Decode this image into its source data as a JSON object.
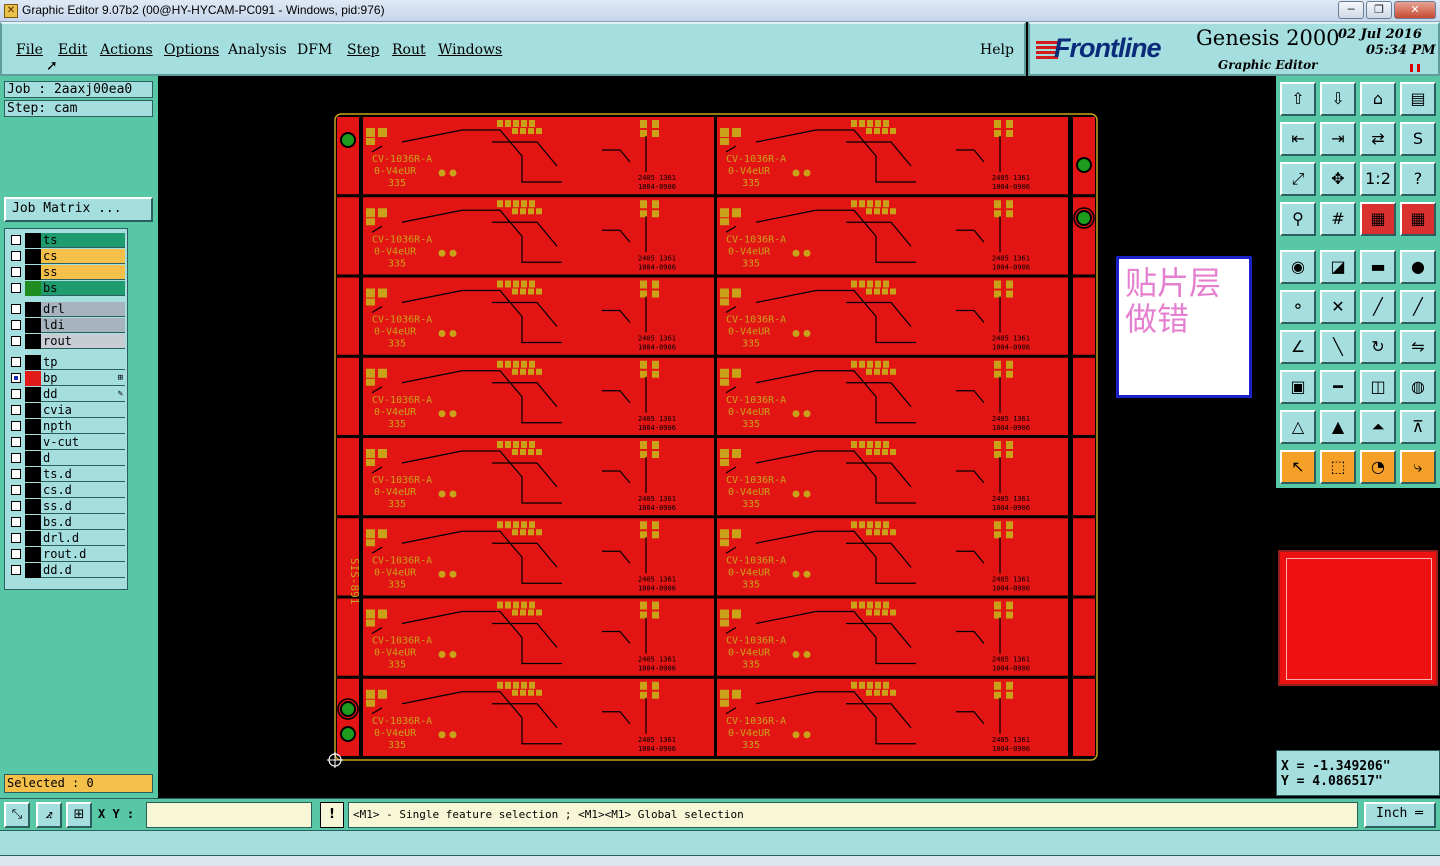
{
  "window": {
    "title": "Graphic Editor 9.07b2 (00@HY-HYCAM-PC091 - Windows, pid:976)",
    "minimize": "─",
    "restore": "❐",
    "close": "✕"
  },
  "menu": {
    "items": [
      "File",
      "Edit",
      "Actions",
      "Options",
      "Analysis",
      "DFM",
      "Step",
      "Rout",
      "Windows"
    ],
    "help": "Help"
  },
  "banner": {
    "logo": "Frontline",
    "product": "Genesis 2000",
    "subtitle": "Graphic Editor",
    "date": "02  Jul  2016",
    "time": "05:34  PM"
  },
  "left": {
    "job": "Job : 2aaxj00ea0",
    "step": "Step: cam",
    "job_matrix": "Job Matrix ...",
    "layers": [
      {
        "name": "ts",
        "color": "#1e9c6e",
        "swatch": "#000000",
        "checked": false
      },
      {
        "name": "cs",
        "color": "#f5c04a",
        "swatch": "#000000",
        "checked": false
      },
      {
        "name": "ss",
        "color": "#f5c04a",
        "swatch": "#000000",
        "checked": false
      },
      {
        "name": "bs",
        "color": "#1e9c6e",
        "swatch": "#1e8c1e",
        "checked": false
      },
      {
        "name": "drl",
        "color": "#a7b3bd",
        "swatch": "#000000",
        "checked": false,
        "gap": true
      },
      {
        "name": "ldi",
        "color": "#a7b3bd",
        "swatch": "#000000",
        "checked": false
      },
      {
        "name": "rout",
        "color": "#c7cdd2",
        "swatch": "#000000",
        "checked": false
      },
      {
        "name": "tp",
        "color": "#a5dede",
        "swatch": "#000000",
        "checked": false,
        "gap": true
      },
      {
        "name": "bp",
        "color": "#a5dede",
        "swatch": "#e31a1a",
        "checked": true,
        "mark": "⊞"
      },
      {
        "name": "dd",
        "color": "#a5dede",
        "swatch": "#000000",
        "checked": false,
        "mark": "✎"
      },
      {
        "name": "cvia",
        "color": "#a5dede",
        "swatch": "#000000",
        "checked": false
      },
      {
        "name": "npth",
        "color": "#a5dede",
        "swatch": "#000000",
        "checked": false
      },
      {
        "name": "v-cut",
        "color": "#a5dede",
        "swatch": "#000000",
        "checked": false
      },
      {
        "name": "d",
        "color": "#a5dede",
        "swatch": "#000000",
        "checked": false
      },
      {
        "name": "ts.d",
        "color": "#a5dede",
        "swatch": "#000000",
        "checked": false
      },
      {
        "name": "cs.d",
        "color": "#a5dede",
        "swatch": "#000000",
        "checked": false
      },
      {
        "name": "ss.d",
        "color": "#a5dede",
        "swatch": "#000000",
        "checked": false
      },
      {
        "name": "bs.d",
        "color": "#a5dede",
        "swatch": "#000000",
        "checked": false
      },
      {
        "name": "drl.d",
        "color": "#a5dede",
        "swatch": "#000000",
        "checked": false
      },
      {
        "name": "rout.d",
        "color": "#a5dede",
        "swatch": "#000000",
        "checked": false
      },
      {
        "name": "dd.d",
        "color": "#a5dede",
        "swatch": "#000000",
        "checked": false
      }
    ],
    "selected": "Selected : 0"
  },
  "canvas": {
    "annotation": "贴片层做错",
    "board_color": "#e31414",
    "pad_color": "#c9a21a",
    "rows": 8,
    "cols": 2,
    "side_label": "SIS-891",
    "panel_texts": [
      "CV-1036R-A",
      "0-V4eUR",
      "335",
      "2405 1361",
      "1004-0906"
    ]
  },
  "tools": {
    "rows": [
      [
        "home-up-icon",
        "save-icon",
        "house-icon",
        "window-split-icon"
      ],
      [
        "pan-left-icon",
        "pan-right-icon",
        "swap-icon",
        "s-route-icon"
      ],
      [
        "fit-all-icon",
        "zoom-center-icon",
        "scale-1-2-icon",
        "help-icon"
      ],
      [
        "measure-icon",
        "grid-icon",
        "layer-red-icon",
        "layer-red2-icon"
      ],
      [
        "snap-center-icon",
        "snap-edge-icon",
        "ruler-icon",
        "snap-point-icon"
      ],
      [
        "connect-icon",
        "cross-icon",
        "line-red-icon",
        "line-red2-icon"
      ],
      [
        "angle-icon",
        "diag-icon",
        "rotate-icon",
        "mirror-icon"
      ],
      [
        "pad-icon",
        "line-bar-icon",
        "box-center-icon",
        "blob-icon"
      ],
      [
        "tri-icon",
        "tri2-icon",
        "tri3-icon",
        "tri4-icon"
      ],
      [
        "arrow-icon",
        "box-arrow-icon",
        "circle-arrow-icon",
        "route-icon"
      ]
    ],
    "glyphs": {
      "home-up-icon": "⇧",
      "save-icon": "⇩",
      "house-icon": "⌂",
      "window-split-icon": "▤",
      "pan-left-icon": "⇤",
      "pan-right-icon": "⇥",
      "swap-icon": "⇄",
      "s-route-icon": "S",
      "fit-all-icon": "⤢",
      "zoom-center-icon": "✥",
      "scale-1-2-icon": "1:2",
      "help-icon": "?",
      "measure-icon": "⚲",
      "grid-icon": "#",
      "layer-red-icon": "▦",
      "layer-red2-icon": "▦",
      "snap-center-icon": "◉",
      "snap-edge-icon": "◪",
      "ruler-icon": "▬",
      "snap-point-icon": "●",
      "connect-icon": "⚬",
      "cross-icon": "✕",
      "line-red-icon": "╱",
      "line-red2-icon": "╱",
      "angle-icon": "∠",
      "diag-icon": "╲",
      "rotate-icon": "↻",
      "mirror-icon": "⇋",
      "pad-icon": "▣",
      "line-bar-icon": "━",
      "box-center-icon": "◫",
      "blob-icon": "◍",
      "tri-icon": "△",
      "tri2-icon": "▲",
      "tri3-icon": "⏶",
      "tri4-icon": "⊼",
      "arrow-icon": "↖",
      "box-arrow-icon": "⬚",
      "circle-arrow-icon": "◔",
      "route-icon": "⤷"
    },
    "active_row": 9,
    "red_tools": [
      "layer-red-icon",
      "layer-red2-icon"
    ]
  },
  "coords": {
    "x": "X = -1.349206\"",
    "y": "Y = 4.086517\""
  },
  "bottom": {
    "xy_label": "X Y :",
    "xy_value": "",
    "message": "<M1> - Single feature selection ; <M1><M1> Global selection",
    "unit": "Inch ═"
  }
}
